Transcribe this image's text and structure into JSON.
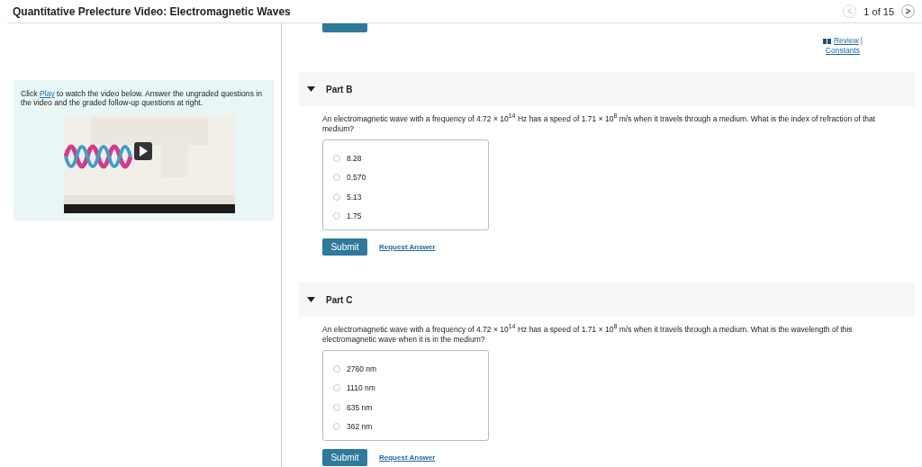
{
  "header": {
    "title": "Quantitative Prelecture Video: Electromagnetic Waves",
    "pager": {
      "prev": "<",
      "position": "1 of 15",
      "next": ">"
    }
  },
  "intro": {
    "before": "Click",
    "link": "Play",
    "after": "to watch the video below. Answer the ungraded questions in the video and the graded follow-up questions at right."
  },
  "resources": {
    "review": "Review",
    "separator": "|",
    "constants": "Constants"
  },
  "parts": [
    {
      "title": "Part B",
      "expanded": true,
      "question": "An electromagnetic wave with a frequency of 4.72 × 10$^{14}$ Hz has a speed of 1.71 × 10$^{8}$ m/s when it travels through a medium. What is the index of refraction of that medium?",
      "choices": [
        {
          "label": "8.28",
          "selected": false
        },
        {
          "label": "0.570",
          "selected": false
        },
        {
          "label": "5.13",
          "selected": false
        },
        {
          "label": "1.75",
          "selected": false
        }
      ],
      "submit": "Submit",
      "request": "Request Answer"
    },
    {
      "title": "Part C",
      "expanded": true,
      "question": "An electromagnetic wave with a frequency of 4.72 × 10$^{14}$ Hz has a speed of 1.71 × 10$^{8}$ m/s when it travels through a medium. What is the wavelength of this electromagnetic wave when it is in the medium?",
      "choices": [
        {
          "label": "2760 nm",
          "selected": false
        },
        {
          "label": "1110 nm",
          "selected": false
        },
        {
          "label": "635 nm",
          "selected": false
        },
        {
          "label": "362 nm",
          "selected": false
        }
      ],
      "submit": "Submit",
      "request": "Request Answer"
    }
  ]
}
